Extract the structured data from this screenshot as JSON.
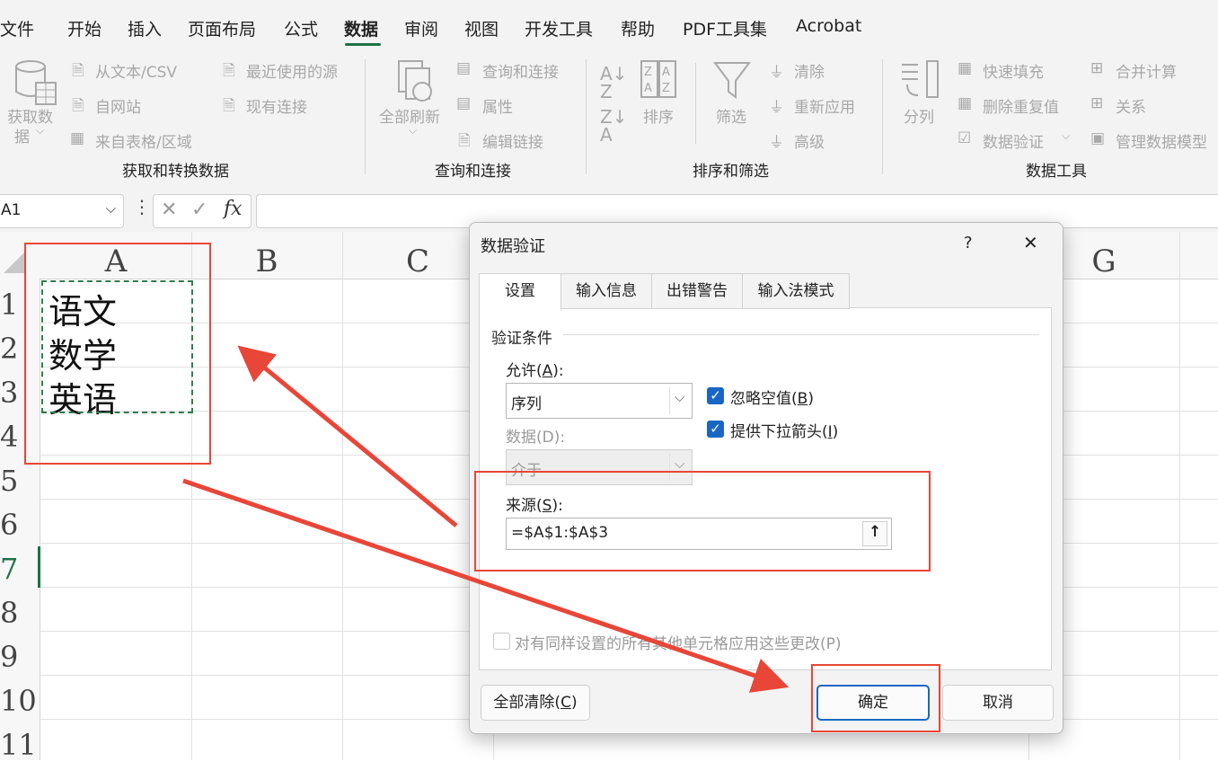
{
  "menu": {
    "items": [
      "文件",
      "开始",
      "插入",
      "页面布局",
      "公式",
      "数据",
      "审阅",
      "视图",
      "开发工具",
      "帮助",
      "PDF工具集",
      "Acrobat"
    ],
    "active": "数据"
  },
  "ribbon": {
    "get_data": {
      "big_label_1": "获取数",
      "big_label_2": "据",
      "from_text_csv": "从文本/CSV",
      "from_web": "自网站",
      "from_table": "来自表格/区域",
      "recent_sources": "最近使用的源",
      "existing_conn": "现有连接",
      "group_label": "获取和转换数据"
    },
    "query": {
      "refresh_all": "全部刷新",
      "queries_conn": "查询和连接",
      "properties": "属性",
      "edit_links": "编辑链接",
      "group_label": "查询和连接"
    },
    "sort_filter": {
      "sort": "排序",
      "filter": "筛选",
      "clear": "清除",
      "reapply": "重新应用",
      "advanced": "高级",
      "group_label": "排序和筛选"
    },
    "data_tools": {
      "text_to_columns": "分列",
      "flash_fill": "快速填充",
      "remove_dup": "删除重复值",
      "data_validation": "数据验证",
      "consolidate": "合并计算",
      "relationships": "关系",
      "manage_model": "管理数据模型",
      "group_label": "数据工具"
    }
  },
  "formula_bar": {
    "name_box": "A1",
    "fx": "fx",
    "formula": ""
  },
  "sheet": {
    "columns": [
      "A",
      "B",
      "C",
      "G"
    ],
    "rows": [
      "1",
      "2",
      "3",
      "4",
      "5",
      "6",
      "7",
      "8",
      "9",
      "10",
      "11"
    ],
    "cells": {
      "A1": "语文",
      "A2": "数学",
      "A3": "英语"
    }
  },
  "dialog": {
    "title": "数据验证",
    "help": "?",
    "close": "✕",
    "tabs": [
      "设置",
      "输入信息",
      "出错警告",
      "输入法模式"
    ],
    "section_label": "验证条件",
    "allow_label": "允许(A):",
    "allow_label_pre": "允许(",
    "allow_label_key": "A",
    "allow_label_post": "):",
    "allow_value": "序列",
    "data_label": "数据(D):",
    "data_value": "介于",
    "ignore_blank": "忽略空值(B)",
    "ignore_blank_pre": "忽略空值(",
    "ignore_blank_key": "B",
    "ignore_blank_post": ")",
    "dropdown": "提供下拉箭头(I)",
    "dropdown_pre": "提供下拉箭头(",
    "dropdown_key": "I",
    "dropdown_post": ")",
    "source_label_pre": "来源(",
    "source_label_key": "S",
    "source_label_post": "):",
    "source_value": "=$A$1:$A$3",
    "apply_all": "对有同样设置的所有其他单元格应用这些更改(P)",
    "clear_all_pre": "全部清除(",
    "clear_all_key": "C",
    "clear_all_post": ")",
    "ok": "确定",
    "cancel": "取消"
  },
  "colors": {
    "annotation_red": "#e84638",
    "accent_green": "#1e7145",
    "checkbox_blue": "#1966c4"
  }
}
